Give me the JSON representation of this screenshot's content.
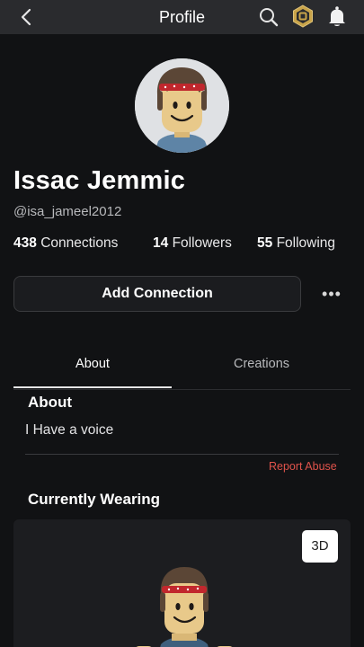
{
  "header": {
    "title": "Profile",
    "back_icon": "chevron-left-icon",
    "search_icon": "search-icon",
    "robux_icon": "robux-icon",
    "notifications_icon": "bell-icon"
  },
  "profile": {
    "display_name": "Issac Jemmic",
    "username": "@isa_jameel2012",
    "stats": [
      {
        "count": "438",
        "label": "Connections"
      },
      {
        "count": "14",
        "label": "Followers"
      },
      {
        "count": "55",
        "label": "Following"
      }
    ]
  },
  "actions": {
    "add_connection_label": "Add Connection",
    "more_label": "•••"
  },
  "tabs": [
    {
      "label": "About",
      "active": true
    },
    {
      "label": "Creations",
      "active": false
    }
  ],
  "about": {
    "heading": "About",
    "text": "I Have a voice",
    "report_label": "Report Abuse"
  },
  "wearing": {
    "heading": "Currently Wearing",
    "view_3d_label": "3D"
  },
  "colors": {
    "background": "#111214",
    "topbar": "#2a2b2e",
    "panel": "#1c1d20",
    "report": "#e0534b",
    "bandana": "#c1272d"
  }
}
